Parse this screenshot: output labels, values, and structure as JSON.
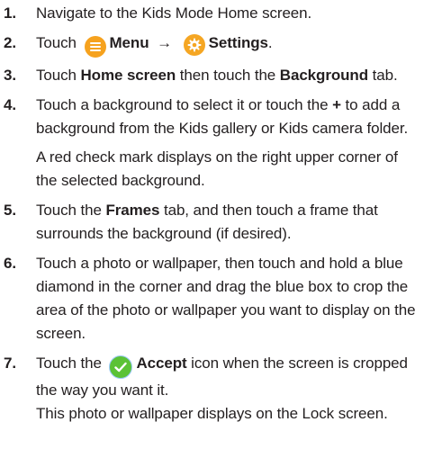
{
  "steps": [
    {
      "num": "1.",
      "t1": "Navigate to the Kids Mode Home screen."
    },
    {
      "num": "2.",
      "t1": "Touch",
      "menu_icon": "menu-icon",
      "menu_label": "Menu",
      "arrow": "→",
      "settings_icon": "settings-icon",
      "settings_label": "Settings",
      "t2": "."
    },
    {
      "num": "3.",
      "t1": "Touch ",
      "home_screen": "Home screen",
      "t2": " then touch the ",
      "background": "Background",
      "t3": " tab."
    },
    {
      "num": "4.",
      "t1": "Touch a background to select it or touch the ",
      "plus": "+",
      "t2": " to add a background from the Kids gallery or Kids camera folder.",
      "note": "A red check mark displays on the right upper corner of the selected background."
    },
    {
      "num": "5.",
      "t1": "Touch the ",
      "frames": "Frames",
      "t2": " tab, and then touch a frame that surrounds the background (if desired)."
    },
    {
      "num": "6.",
      "t1": "Touch a photo or wallpaper, then touch and hold a blue diamond in the corner and drag the blue box to crop the area of the photo or wallpaper you want to display on the screen."
    },
    {
      "num": "7.",
      "t1": "Touch the",
      "accept_icon": "check-circle-icon",
      "accept_label": "Accept",
      "t2": " icon when the screen is cropped the way you want it.",
      "note": "This photo or wallpaper displays on the Lock screen."
    }
  ],
  "colors": {
    "text": "#231f20",
    "menu_icon_bg": "#f6a21e",
    "settings_icon_bg": "#f5a623",
    "accept_icon_bg": "#5bc236"
  }
}
